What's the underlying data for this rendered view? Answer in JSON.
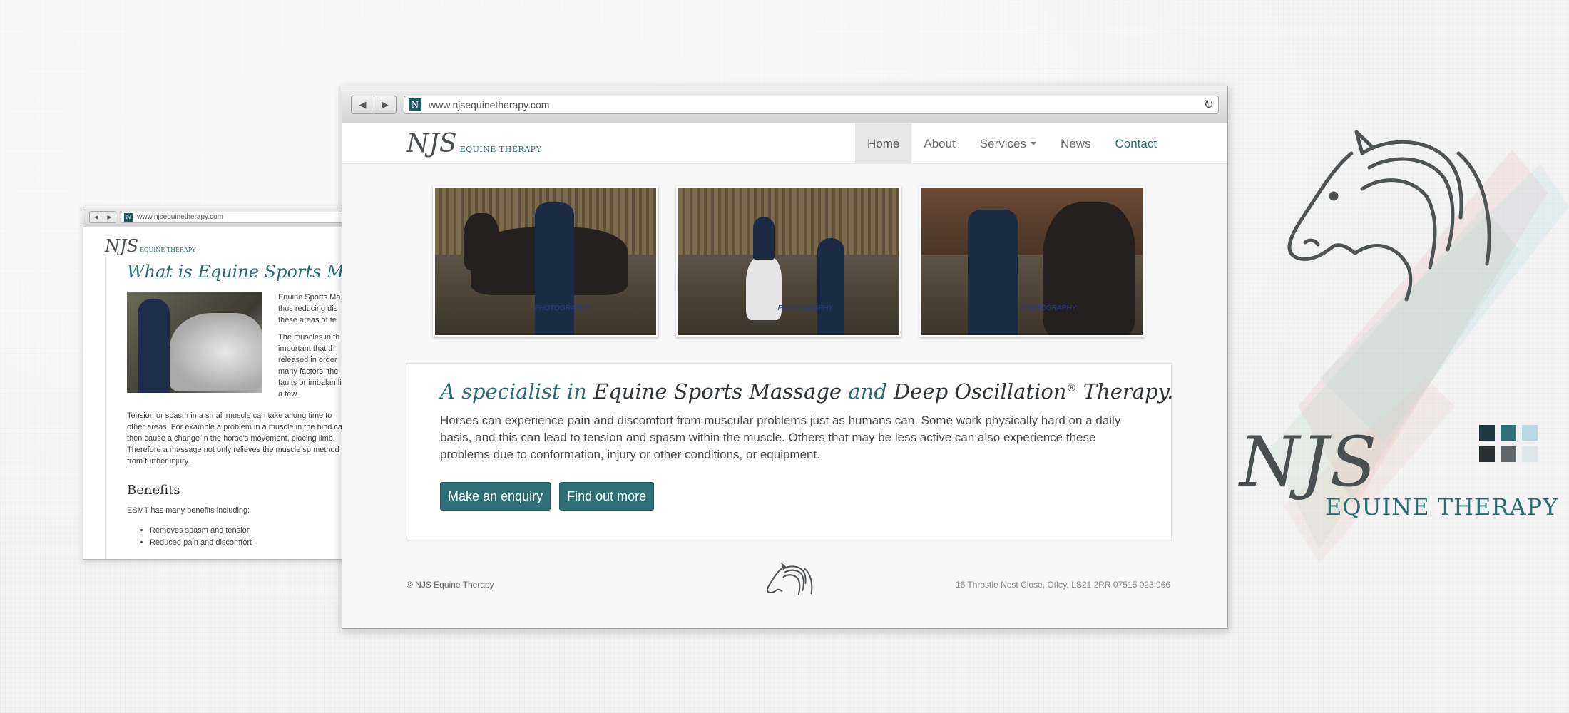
{
  "brand": {
    "title": "NJS",
    "subtitle": "EQUINE THERAPY",
    "swatch_colors": [
      "#1e3a40",
      "#2e6f78",
      "#b7d8e0",
      "#2a2f32",
      "#5e6468",
      "#dde7ea"
    ]
  },
  "back_window": {
    "url": "www.njsequinetherapy.com",
    "logo": "NJS",
    "logo_sub": "EQUINE THERAPY",
    "heading": "What is Equine Sports Mass",
    "side_text_1": "Equine Sports Ma thus reducing dis these areas of te",
    "side_text_2": "The muscles in th important that th released in order many factors; the faults or imbalan list a few.",
    "paragraph": "Tension or spasm in a small muscle can take a long time to other areas. For example a problem in a muscle in the hind can then cause a change in the horse's movement, placing limb. Therefore a massage not only relieves the muscle sp method from further injury.",
    "benefits_heading": "Benefits",
    "benefits_intro": "ESMT has many benefits including:",
    "benefits": [
      "Removes spasm and tension",
      "Reduced pain and discomfort"
    ]
  },
  "browser": {
    "back": "◀",
    "forward": "▶",
    "favicon": "N",
    "url": "www.njsequinetherapy.com",
    "reload": "↻"
  },
  "site": {
    "logo": "NJS",
    "logo_sub": "EQUINE THERAPY",
    "menu": [
      "Home",
      "About",
      "Services",
      "News",
      "Contact"
    ],
    "active_menu": "Home",
    "photo_watermark": "PHOTOGRAPHY",
    "intro": {
      "title_1": "A specialist in ",
      "title_2": "Equine Sports Massage",
      "title_3": " and ",
      "title_4": "Deep Oscillation",
      "title_sup": "®",
      "title_5": " Therapy.",
      "text": "Horses can experience pain and discomfort from muscular problems just as humans can. Some work physically hard on a daily basis, and this can lead to tension and spasm within the muscle. Others that may be less active can also experience these problems due to conformation, injury or other conditions, or equipment.",
      "button_enquiry": "Make an enquiry",
      "button_more": "Find out more"
    },
    "footer": {
      "copyright": "© NJS Equine Therapy",
      "address": "16 Throstle Nest Close, Otley, LS21 2RR   07515 023 966"
    }
  }
}
